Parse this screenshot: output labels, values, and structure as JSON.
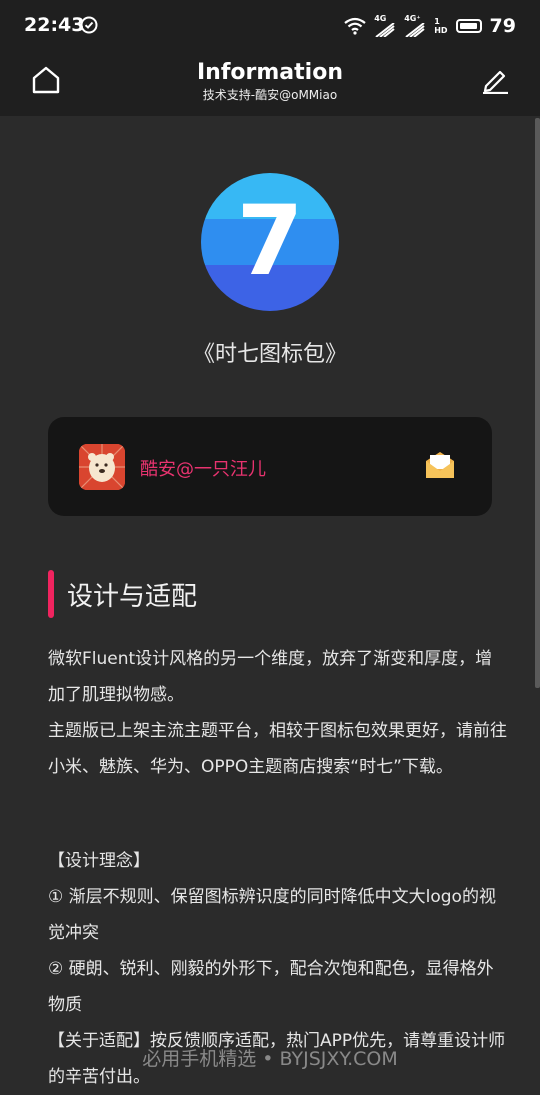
{
  "status_bar": {
    "time": "22:43",
    "signal1": "4G",
    "signal2": "4G⁺",
    "hd": "1\nHD",
    "battery": "79"
  },
  "header": {
    "title": "Information",
    "subtitle": "技术支持-酷安@oMMiao"
  },
  "logo": {
    "glyph": "7",
    "colors": [
      "#37b8f4",
      "#2f8ef0",
      "#3d63e6"
    ]
  },
  "pack_name": "《时七图标包》",
  "author": {
    "name": "酷安@一只汪儿"
  },
  "section": {
    "title": "设计与适配",
    "accent": "#f0245f"
  },
  "content": {
    "paragraph1": "微软Fluent设计风格的另一个维度，放弃了渐变和厚度，增加了肌理拟物感。\n主题版已上架主流主题平台，相较于图标包效果更好，请前往小米、魅族、华为、OPPO主题商店搜索“时七”下载。",
    "paragraph2": "【设计理念】\n① 渐层不规则、保留图标辨识度的同时降低中文大logo的视觉冲突\n② 硬朗、锐利、刚毅的外形下，配合次饱和配色，显得格外物质\n【关于适配】按反馈顺序适配，热门APP优先，请尊重设计师的辛苦付出。"
  },
  "watermark": "必用手机精选 • BYJSJXY.COM"
}
